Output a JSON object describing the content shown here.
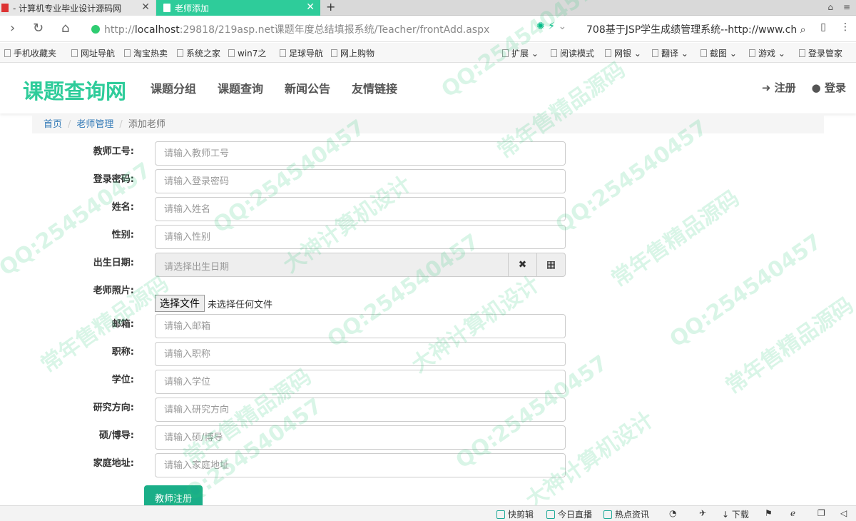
{
  "browser": {
    "tabs": [
      {
        "label": "- 计算机专业毕业设计源码网"
      },
      {
        "label": "老师添加"
      }
    ],
    "new_tab": "+",
    "url_prefix": "http://",
    "url_host": "localhost",
    "url_rest": ":29818/219asp.net课题年度总结填报系统/Teacher/frontAdd.aspx",
    "search_text": "708基于JSP学生成绩管理系统--http://www.ch",
    "bookmarks": [
      "手机收藏夹",
      "网址导航",
      "淘宝热卖",
      "系统之家",
      "win7之",
      "足球导航",
      "网上购物"
    ],
    "toolbar": [
      "扩展",
      "阅读模式",
      "网银",
      "翻译",
      "截图",
      "游戏",
      "登录管家"
    ]
  },
  "site": {
    "logo": "课题查询网",
    "nav": [
      "课题分组",
      "课题查询",
      "新闻公告",
      "友情链接"
    ],
    "register": "注册",
    "login": "登录"
  },
  "breadcrumb": {
    "home": "首页",
    "section": "老师管理",
    "current": "添加老师",
    "sep": "/"
  },
  "form": {
    "fields": [
      {
        "label": "教师工号:",
        "placeholder": "请输入教师工号"
      },
      {
        "label": "登录密码:",
        "placeholder": "请输入登录密码"
      },
      {
        "label": "姓名:",
        "placeholder": "请输入姓名"
      },
      {
        "label": "性别:",
        "placeholder": "请输入性别"
      },
      {
        "label": "出生日期:",
        "placeholder": "请选择出生日期"
      },
      {
        "label": "老师照片:",
        "button": "选择文件",
        "status": "未选择任何文件"
      },
      {
        "label": "邮箱:",
        "placeholder": "请输入邮箱"
      },
      {
        "label": "职称:",
        "placeholder": "请输入职称"
      },
      {
        "label": "学位:",
        "placeholder": "请输入学位"
      },
      {
        "label": "研究方向:",
        "placeholder": "请输入研究方向"
      },
      {
        "label": "硕/博导:",
        "placeholder": "请输入硕/博导"
      },
      {
        "label": "家庭地址:",
        "placeholder": "请输入家庭地址"
      }
    ],
    "submit": "教师注册"
  },
  "statusbar": [
    "快剪辑",
    "今日直播",
    "热点资讯",
    "下载"
  ],
  "watermarks": [
    "QQ:254540457",
    "大神计算机设计",
    "常年售精品源码"
  ]
}
